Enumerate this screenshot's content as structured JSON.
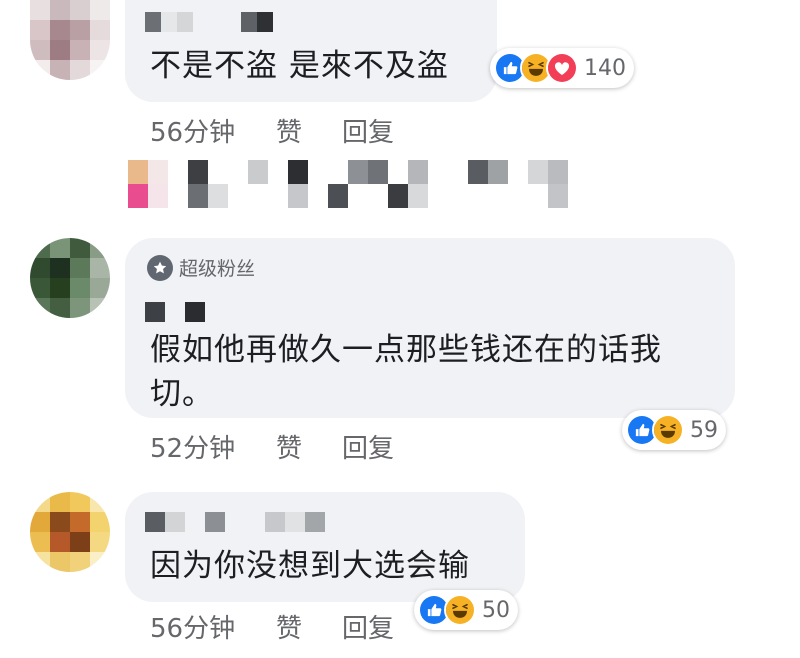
{
  "comments": [
    {
      "text": "不是不盗 是來不及盗",
      "time": "56分钟",
      "like_label": "赞",
      "reply_label": "回复",
      "reaction_count": "140",
      "reactions": [
        "like",
        "haha",
        "love"
      ]
    },
    {
      "badge": "超级粉丝",
      "text": "假如他再做久一点那些钱还在的话我切。",
      "time": "52分钟",
      "like_label": "赞",
      "reply_label": "回复",
      "reaction_count": "59",
      "reactions": [
        "like",
        "haha"
      ]
    },
    {
      "text": "因为你没想到大选会输",
      "time": "56分钟",
      "like_label": "赞",
      "reply_label": "回复",
      "reaction_count": "50",
      "reactions": [
        "like",
        "haha"
      ]
    }
  ],
  "colors": {
    "like": "#1877f2",
    "haha": "#f7b125",
    "love": "#f33e58",
    "bubble": "#f0f2f5",
    "meta_text": "#65676b"
  }
}
